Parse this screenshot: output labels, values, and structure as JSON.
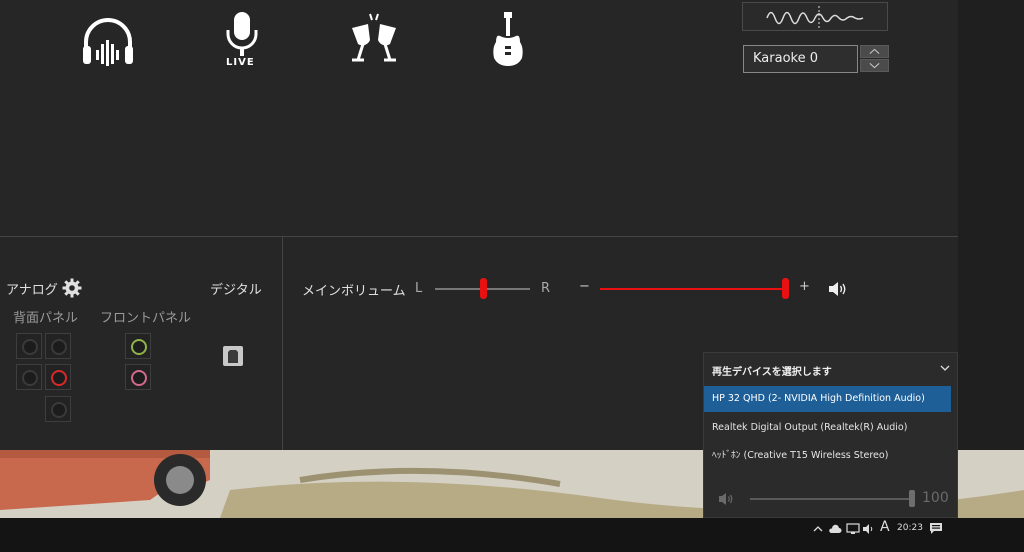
{
  "modes": [
    {
      "name": "headphone-mode",
      "icon": "headphone-icon"
    },
    {
      "name": "live-mic-mode",
      "icon": "microphone-live-icon",
      "label": "LIVE"
    },
    {
      "name": "party-mode",
      "icon": "toast-glasses-icon"
    },
    {
      "name": "guitar-mode",
      "icon": "guitar-icon"
    }
  ],
  "preset": {
    "value": "Karaoke 0"
  },
  "analog": {
    "title": "アナログ",
    "rear_label": "背面パネル",
    "front_label": "フロントパネル"
  },
  "digital": {
    "title": "デジタル"
  },
  "volume": {
    "label": "メインボリューム",
    "balance_left": "L",
    "balance_right": "R",
    "balance": 0.5,
    "minus": "−",
    "plus": "+",
    "level": 1.0
  },
  "colors": {
    "accent": "#e81010",
    "selected": "#1f5f98",
    "jack_green": "#8fb24a",
    "jack_pink": "#d26a8a",
    "jack_red": "#d62a2a"
  },
  "device_popup": {
    "title": "再生デバイスを選択します",
    "devices": [
      {
        "label": "HP 32 QHD (2- NVIDIA High Definition Audio)",
        "selected": true
      },
      {
        "label": "Realtek Digital Output (Realtek(R) Audio)",
        "selected": false
      },
      {
        "label": "ﾍｯﾄﾞﾎﾝ (Creative T15 Wireless Stereo)",
        "selected": false
      }
    ],
    "volume_value": "100"
  },
  "taskbar": {
    "clock": "20:23",
    "ime": "A"
  }
}
